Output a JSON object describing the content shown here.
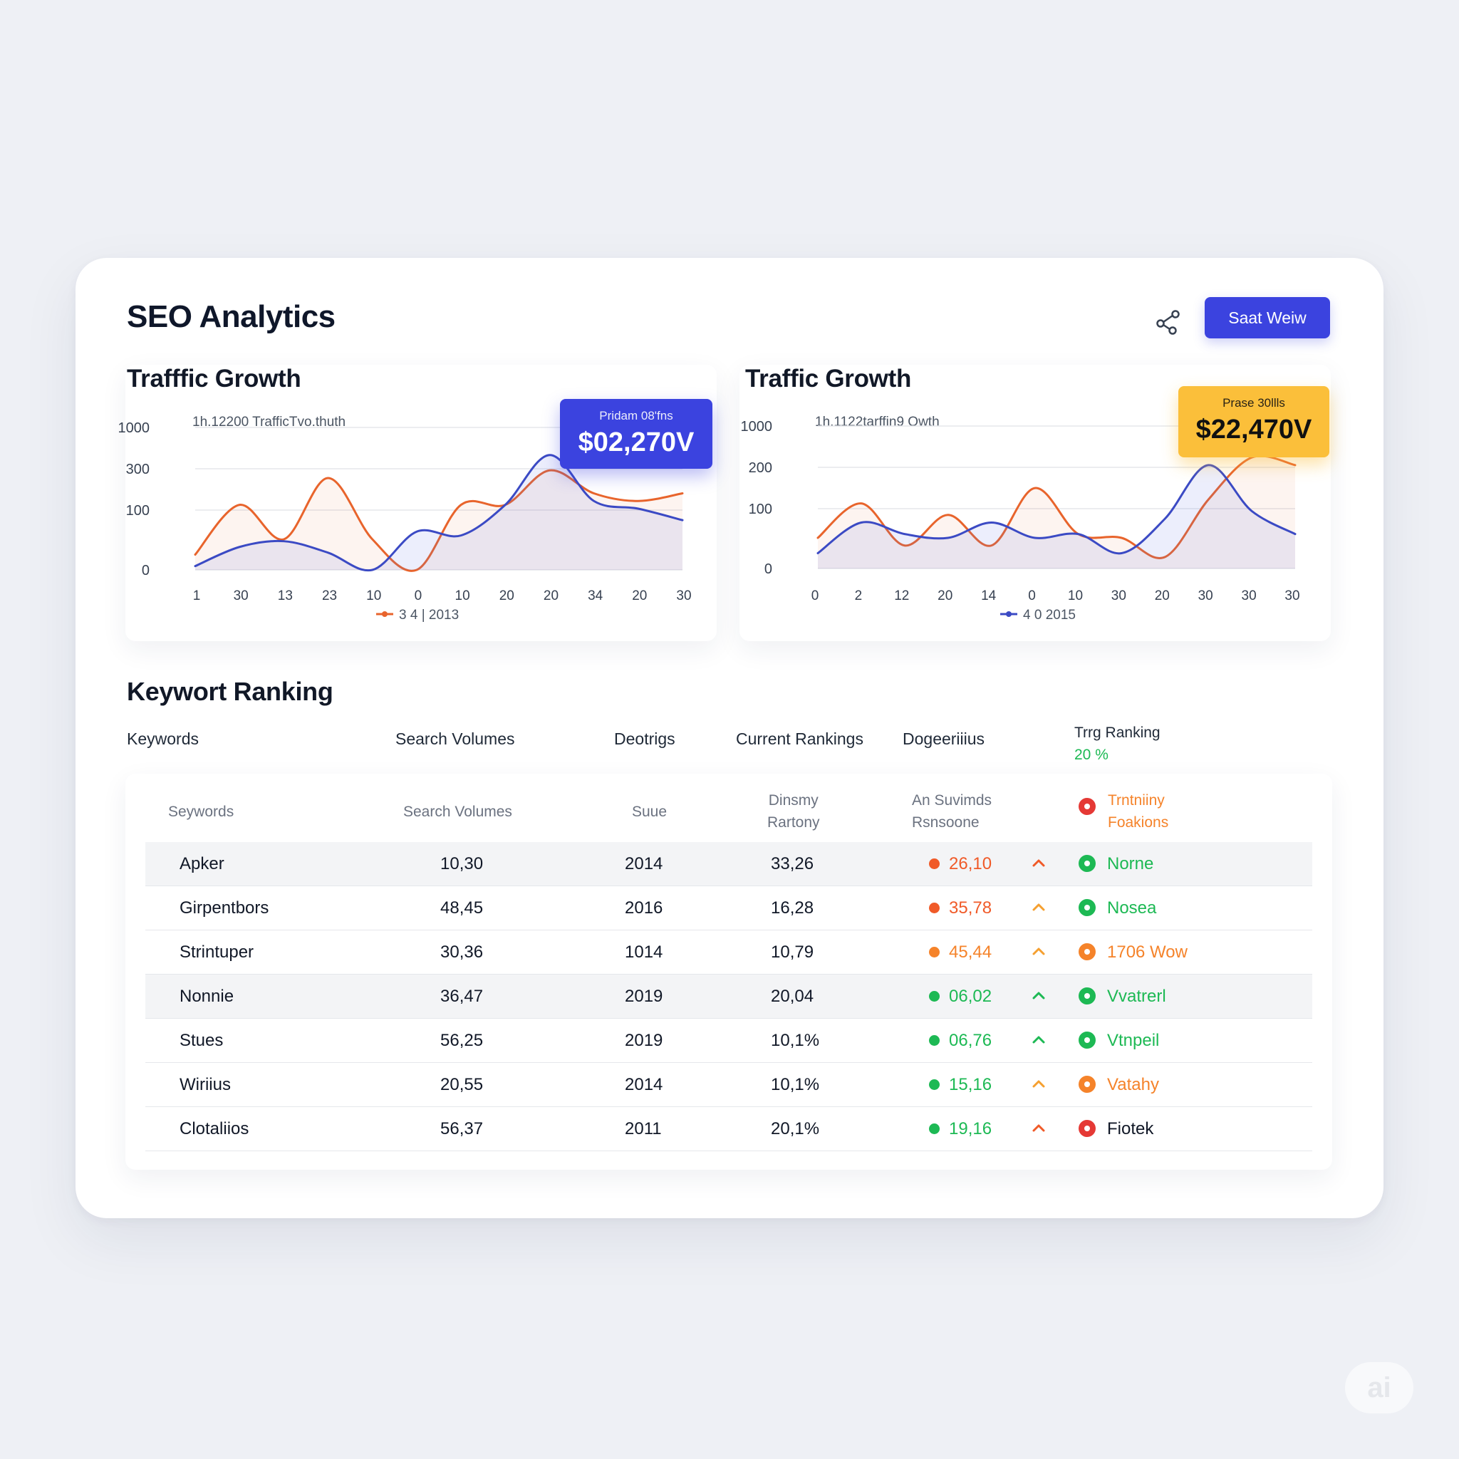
{
  "header": {
    "title": "SEO Analytics",
    "button_label": "Saat Weiw",
    "share_icon": "share-icon"
  },
  "charts": [
    {
      "heading": "Trafffic Growth",
      "subtitle": "1h.12200 TrafficTvo.thuth",
      "legend_label": "3 4 | 2013",
      "tooltip": {
        "label": "Pridam 08'fns",
        "value": "$02,270V"
      }
    },
    {
      "heading": "Traffic Growth",
      "subtitle": "1h.1122tarffin9 Owth",
      "legend_label": "4 0 2015",
      "tooltip": {
        "label": "Prase 30llls",
        "value": "$22,470V"
      }
    }
  ],
  "chart_data": [
    {
      "type": "line",
      "y_tick_labels": [
        "1000",
        "300",
        "100",
        "0"
      ],
      "x": [
        "1",
        "30",
        "13",
        "23",
        "10",
        "0",
        "10",
        "20",
        "20",
        "34",
        "20",
        "30"
      ],
      "series": [
        {
          "color": "#e8642c",
          "values": [
            40,
            170,
            80,
            240,
            80,
            0,
            170,
            170,
            260,
            200,
            180,
            200
          ]
        },
        {
          "color": "#3b4ac4",
          "values": [
            10,
            60,
            75,
            45,
            0,
            100,
            90,
            170,
            300,
            180,
            160,
            130
          ]
        }
      ]
    },
    {
      "type": "line",
      "y_tick_labels": [
        "1000",
        "200",
        "100",
        "0"
      ],
      "x": [
        "0",
        "2",
        "12",
        "20",
        "14",
        "0",
        "10",
        "30",
        "20",
        "30",
        "30",
        "30"
      ],
      "series": [
        {
          "color": "#e8642c",
          "values": [
            80,
            170,
            60,
            140,
            60,
            210,
            90,
            80,
            30,
            180,
            290,
            270
          ]
        },
        {
          "color": "#3b4ac4",
          "values": [
            40,
            120,
            90,
            80,
            120,
            80,
            90,
            40,
            130,
            270,
            150,
            90
          ]
        }
      ]
    }
  ],
  "keyword_section": {
    "title": "Keywort Ranking",
    "headers": [
      "Keywords",
      "Search Volumes",
      "Deotrigs",
      "Current Rankings",
      "Dogeeriiius",
      "Trrg Ranking"
    ],
    "header_extra": "20 %",
    "sub_headers": [
      "Seywords",
      "Search Volumes",
      "Suue",
      "Dinsmy\nRartony",
      "An Suvimds\nRsnsoone",
      "Trntniiny\nFoakions"
    ],
    "rows": [
      {
        "keyword": "Apker",
        "volume": "10,30",
        "year": "2014",
        "rank": "33,26",
        "change": "26,10",
        "change_color": "#f05a28",
        "arrow_color": "#f05a28",
        "status": "Norne",
        "status_color": "#1db954"
      },
      {
        "keyword": "Girpentbors",
        "volume": "48,45",
        "year": "2016",
        "rank": "16,28",
        "change": "35,78",
        "change_color": "#f05a28",
        "arrow_color": "#f5a030",
        "status": "Nosea",
        "status_color": "#1db954"
      },
      {
        "keyword": "Strintuper",
        "volume": "30,36",
        "year": "1014",
        "rank": "10,79",
        "change": "45,44",
        "change_color": "#f5832a",
        "arrow_color": "#f5a030",
        "status": "1706 Wow",
        "status_color": "#f5832a"
      },
      {
        "keyword": "Nonnie",
        "volume": "36,47",
        "year": "2019",
        "rank": "20,04",
        "change": "06,02",
        "change_color": "#1db954",
        "arrow_color": "#1db954",
        "status": "Vvatrerl",
        "status_color": "#1db954"
      },
      {
        "keyword": "Stues",
        "volume": "56,25",
        "year": "2019",
        "rank": "10,1%",
        "change": "06,76",
        "change_color": "#1db954",
        "arrow_color": "#1db954",
        "status": "Vtnpeil",
        "status_color": "#1db954"
      },
      {
        "keyword": "Wiriius",
        "volume": "20,55",
        "year": "2014",
        "rank": "10,1%",
        "change": "15,16",
        "change_color": "#1db954",
        "arrow_color": "#f5a030",
        "status": "Vatahy",
        "status_color": "#f5832a"
      },
      {
        "keyword": "Clotaliios",
        "volume": "56,37",
        "year": "2011",
        "rank": "20,1%",
        "change": "19,16",
        "change_color": "#1db954",
        "arrow_color": "#f05a28",
        "status": "Fiotek",
        "status_color": "#e53935"
      }
    ]
  },
  "colors": {
    "accent_blue": "#3b43df",
    "accent_amber": "#fbbf3a",
    "line_orange": "#e8642c",
    "line_blue": "#3b4ac4"
  },
  "watermark": "ai"
}
